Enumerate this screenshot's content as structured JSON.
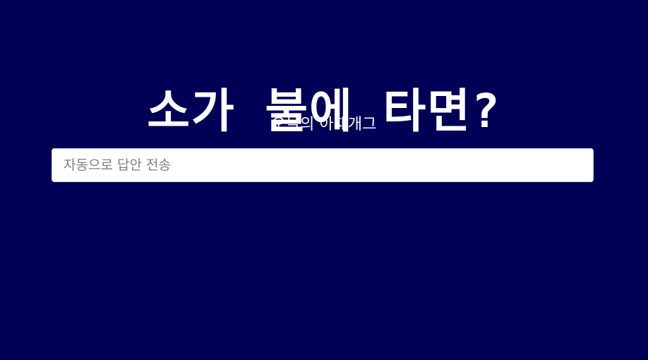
{
  "quiz": {
    "title": "소가 불에 타면?",
    "subtitle": "오늘의 아재개그"
  },
  "answer_input": {
    "value": "",
    "placeholder": "자동으로 답안 전송"
  },
  "colors": {
    "background": "#000057",
    "text": "#ffffff",
    "input_background": "#ffffff",
    "placeholder": "#7a7f85"
  }
}
